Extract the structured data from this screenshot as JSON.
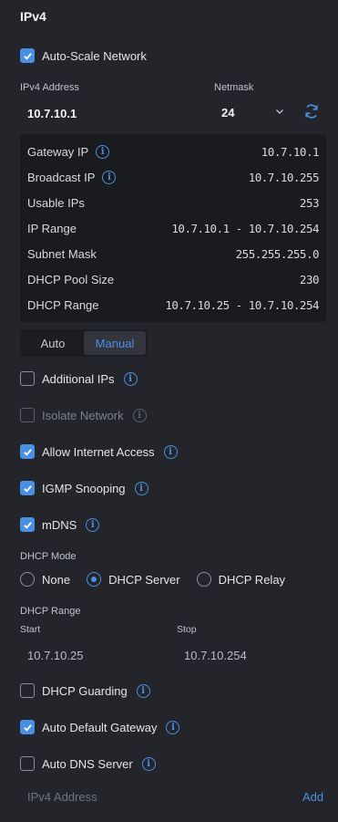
{
  "section_title": "IPv4",
  "auto_scale": {
    "label": "Auto-Scale Network",
    "checked": true
  },
  "ipv4": {
    "address_label": "IPv4 Address",
    "address_value": "10.7.10.1",
    "netmask_label": "Netmask",
    "netmask_value": "24"
  },
  "summary": [
    {
      "key": "Gateway IP",
      "value": "10.7.10.1",
      "info": true
    },
    {
      "key": "Broadcast IP",
      "value": "10.7.10.255",
      "info": true
    },
    {
      "key": "Usable IPs",
      "value": "253",
      "info": false
    },
    {
      "key": "IP Range",
      "value": "10.7.10.1 - 10.7.10.254",
      "info": false
    },
    {
      "key": "Subnet Mask",
      "value": "255.255.255.0",
      "info": false
    },
    {
      "key": "DHCP Pool Size",
      "value": "230",
      "info": false
    },
    {
      "key": "DHCP Range",
      "value": "10.7.10.25 - 10.7.10.254",
      "info": false
    }
  ],
  "mode_tabs": {
    "auto": "Auto",
    "manual": "Manual",
    "active": "Manual"
  },
  "options": {
    "additional_ips": {
      "label": "Additional IPs",
      "checked": false
    },
    "isolate_network": {
      "label": "Isolate Network",
      "checked": false,
      "disabled": true
    },
    "allow_internet": {
      "label": "Allow Internet Access",
      "checked": true
    },
    "igmp": {
      "label": "IGMP Snooping",
      "checked": true
    },
    "mdns": {
      "label": "mDNS",
      "checked": true
    }
  },
  "dhcp_mode": {
    "label": "DHCP Mode",
    "options": [
      "None",
      "DHCP Server",
      "DHCP Relay"
    ],
    "selected": "DHCP Server"
  },
  "dhcp_range": {
    "label": "DHCP Range",
    "start_label": "Start",
    "start_value": "10.7.10.25",
    "stop_label": "Stop",
    "stop_value": "10.7.10.254"
  },
  "options2": {
    "dhcp_guarding": {
      "label": "DHCP Guarding",
      "checked": false
    },
    "auto_default_gateway": {
      "label": "Auto Default Gateway",
      "checked": true
    },
    "auto_dns": {
      "label": "Auto DNS Server",
      "checked": false
    }
  },
  "dns_input": {
    "placeholder": "IPv4 Address",
    "add_label": "Add"
  },
  "colors": {
    "accent": "#4a90e2",
    "background": "#23252b",
    "panel": "#1a1b1f"
  }
}
